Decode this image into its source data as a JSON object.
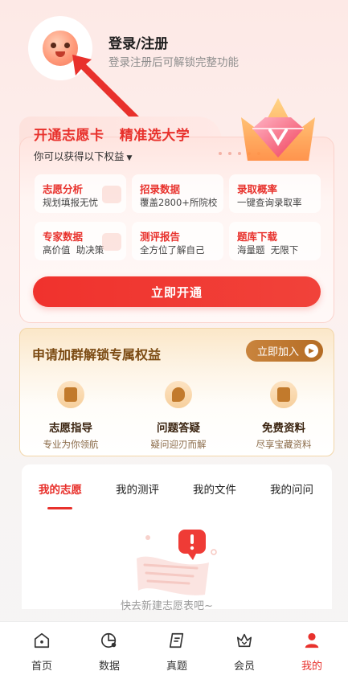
{
  "header": {
    "login_title": "登录/注册",
    "login_subtitle": "登录注册后可解锁完整功能"
  },
  "vip_card": {
    "title": "开通志愿卡   精准选大学",
    "subtitle": "你可以获得以下权益",
    "features": [
      {
        "title": "志愿分析",
        "desc": "规划填报无忧"
      },
      {
        "title": "招录数据",
        "desc": "覆盖2800+所院校"
      },
      {
        "title": "录取概率",
        "desc": "一键查询录取率"
      },
      {
        "title": "专家数据",
        "desc": "高价值  助决策"
      },
      {
        "title": "测评报告",
        "desc": "全方位了解自己"
      },
      {
        "title": "题库下载",
        "desc": "海量题  无限下"
      }
    ],
    "open_button": "立即开通"
  },
  "group_card": {
    "title": "申请加群解锁专属权益",
    "join_button": "立即加入",
    "perks": [
      {
        "title": "志愿指导",
        "desc": "专业为你领航"
      },
      {
        "title": "问题答疑",
        "desc": "疑问迎刃而解"
      },
      {
        "title": "免费资料",
        "desc": "尽享宝藏资料"
      }
    ]
  },
  "tabs": {
    "items": [
      "我的志愿",
      "我的测评",
      "我的文件",
      "我的问问"
    ],
    "active_index": 0,
    "empty_text": "快去新建志愿表吧~"
  },
  "bottom_nav": {
    "items": [
      {
        "label": "首页",
        "icon": "home-icon"
      },
      {
        "label": "数据",
        "icon": "data-icon"
      },
      {
        "label": "真题",
        "icon": "exam-icon"
      },
      {
        "label": "会员",
        "icon": "vip-crown-icon"
      },
      {
        "label": "我的",
        "icon": "user-icon"
      }
    ],
    "active_index": 4
  },
  "colors": {
    "accent": "#e8312c",
    "gold": "#b46c24"
  }
}
